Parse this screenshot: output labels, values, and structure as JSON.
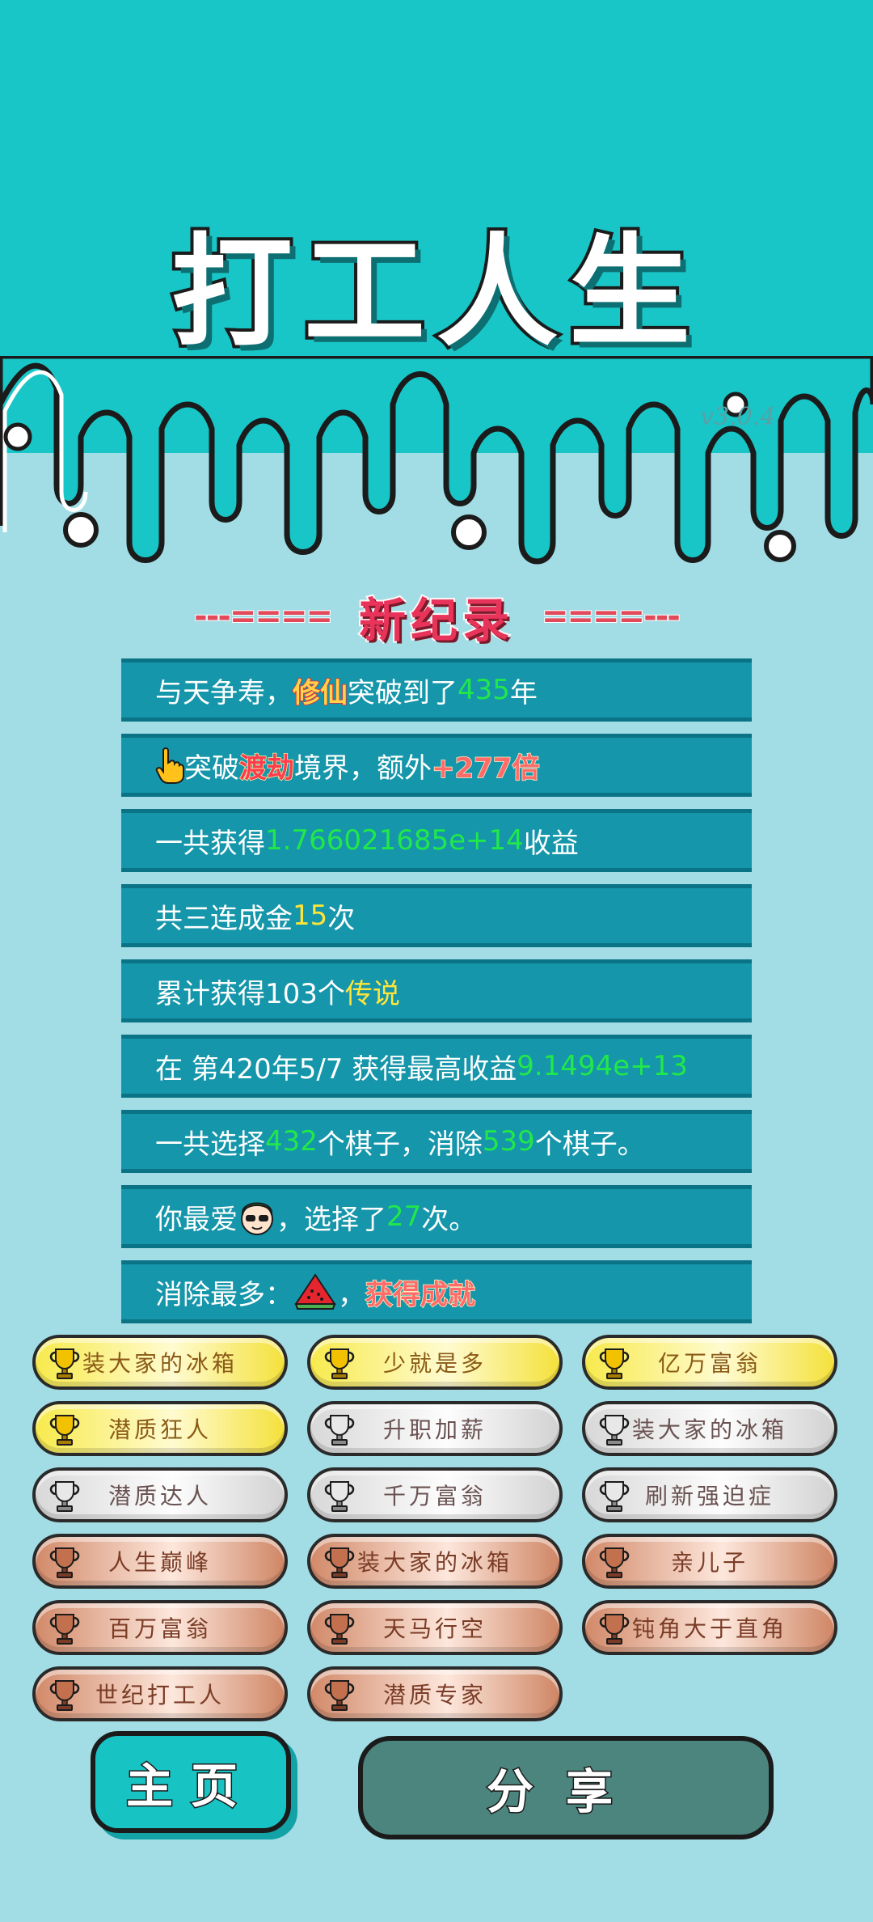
{
  "header": {
    "title": "打工人生",
    "version": "v3.0.4"
  },
  "record": {
    "title": "新纪录",
    "deco_left": "---====",
    "deco_right": "====---"
  },
  "stats": {
    "row1": {
      "a": "与天争寿，",
      "b": "修仙",
      "c": "突破到了",
      "d": "435",
      "e": "年"
    },
    "row2": {
      "b": "突破",
      "c": "渡劫",
      "d": "境界，额外",
      "e": "+277倍"
    },
    "row3": {
      "a": "一共获得",
      "b": "1.766021685e+14",
      "c": "收益"
    },
    "row4": {
      "a": "共三连成金",
      "b": "15",
      "c": "次"
    },
    "row5": {
      "a": "累计获得103个",
      "b": "传说"
    },
    "row6": {
      "a": "在 第420年5/7 获得最高收益",
      "b": "9.1494e+13"
    },
    "row7": {
      "a": "一共选择",
      "b": "432",
      "c": "个棋子，消除",
      "d": "539",
      "e": "个棋子。"
    },
    "row8": {
      "a": "你最爱",
      "b": "，选择了",
      "c": "27",
      "d": "次。"
    },
    "row9": {
      "a": "消除最多：",
      "b": "，",
      "c": "获得成就"
    }
  },
  "icons": {
    "pointer": "hand-pointer-icon",
    "favorite": "avatar-glasses-icon",
    "most": "watermelon-icon",
    "trophy": "trophy-icon"
  },
  "achievements": [
    {
      "label": "装大家的冰箱",
      "tier": "gold"
    },
    {
      "label": "少就是多",
      "tier": "gold"
    },
    {
      "label": "亿万富翁",
      "tier": "gold"
    },
    {
      "label": "潜质狂人",
      "tier": "gold"
    },
    {
      "label": "升职加薪",
      "tier": "silver"
    },
    {
      "label": "装大家的冰箱",
      "tier": "silver"
    },
    {
      "label": "潜质达人",
      "tier": "silver"
    },
    {
      "label": "千万富翁",
      "tier": "silver"
    },
    {
      "label": "刷新强迫症",
      "tier": "silver"
    },
    {
      "label": "人生巅峰",
      "tier": "bronze"
    },
    {
      "label": "装大家的冰箱",
      "tier": "bronze"
    },
    {
      "label": "亲儿子",
      "tier": "bronze"
    },
    {
      "label": "百万富翁",
      "tier": "bronze"
    },
    {
      "label": "天马行空",
      "tier": "bronze"
    },
    {
      "label": "钝角大于直角",
      "tier": "bronze"
    },
    {
      "label": "世纪打工人",
      "tier": "bronze"
    },
    {
      "label": "潜质专家",
      "tier": "bronze"
    }
  ],
  "colors": {
    "gold": "#f7ea4d",
    "silver": "#d8d8d8",
    "bronze": "#d28a6a",
    "teal": "#18c6c7",
    "row": "#1596aa"
  },
  "buttons": {
    "home": "主页",
    "share": "分享"
  }
}
